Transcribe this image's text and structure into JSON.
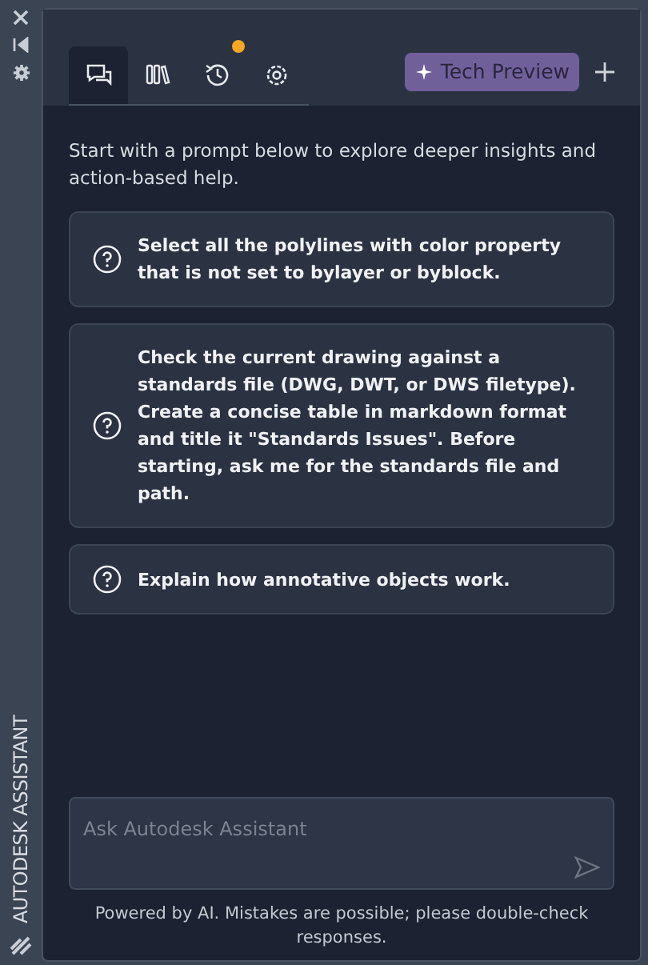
{
  "side_strip": {
    "title": "AUTODESK ASSISTANT"
  },
  "tabs": [
    {
      "kind": "chat",
      "selected": true,
      "badge": false
    },
    {
      "kind": "library",
      "selected": false,
      "badge": false
    },
    {
      "kind": "history",
      "selected": false,
      "badge": true
    },
    {
      "kind": "settings",
      "selected": false,
      "badge": false
    }
  ],
  "tech_preview": {
    "label": "Tech Preview"
  },
  "intro": "Start with a prompt below to explore deeper insights and action-based help.",
  "prompts": [
    "Select all the polylines with color property that is not set to bylayer or byblock.",
    "Check the current drawing against a standards file (DWG, DWT, or DWS filetype). Create a concise table in markdown format and title it \"Standards Issues\". Before starting, ask me for the standards file and path.",
    "Explain how annotative objects work."
  ],
  "input": {
    "placeholder": "Ask Autodesk Assistant"
  },
  "disclaimer": "Powered by AI. Mistakes are possible; please double-check responses."
}
